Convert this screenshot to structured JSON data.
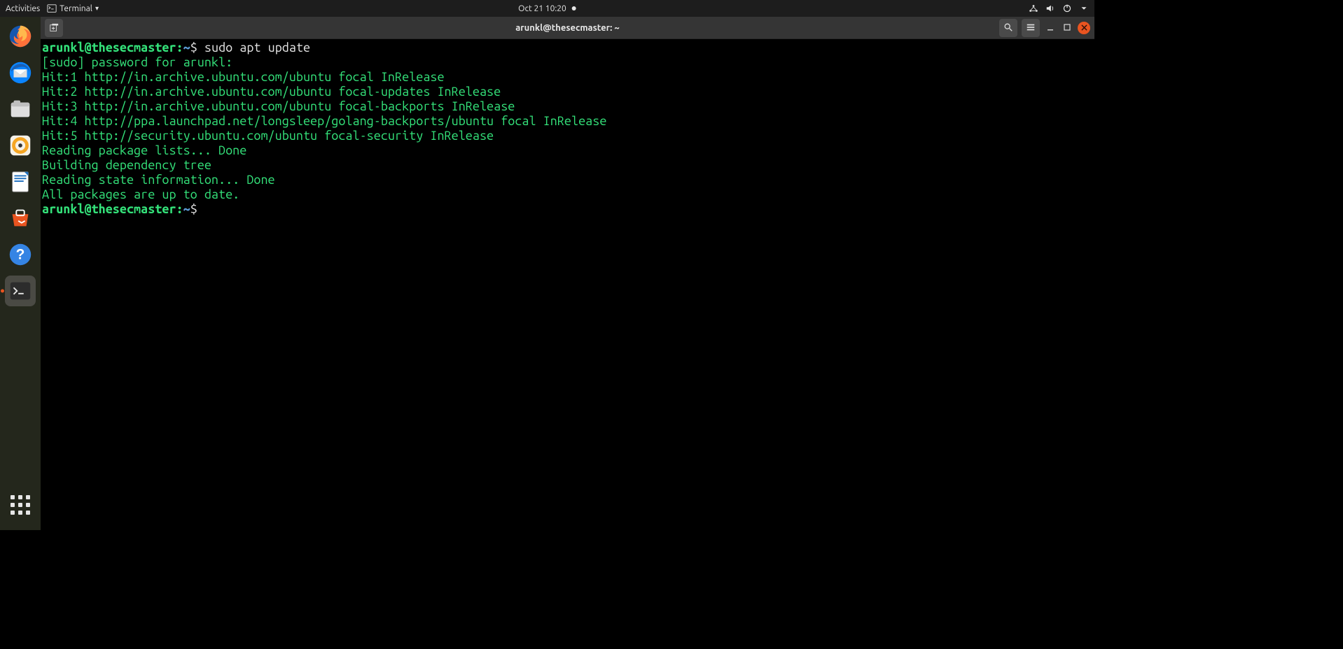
{
  "topbar": {
    "activities": "Activities",
    "terminal_label": "Terminal",
    "datetime": "Oct 21  10:20"
  },
  "dock_icons": [
    "firefox",
    "thunderbird",
    "files",
    "rhythmbox",
    "writer",
    "software",
    "help",
    "terminal"
  ],
  "window": {
    "title": "arunkl@thesecmaster: ~"
  },
  "terminal": {
    "prompt_user_host": "arunkl@thesecmaster",
    "prompt_path": "~",
    "prompt_symbol": "$",
    "command1": "sudo apt update",
    "output": [
      "[sudo] password for arunkl:",
      "Hit:1 http://in.archive.ubuntu.com/ubuntu focal InRelease",
      "Hit:2 http://in.archive.ubuntu.com/ubuntu focal-updates InRelease",
      "Hit:3 http://in.archive.ubuntu.com/ubuntu focal-backports InRelease",
      "Hit:4 http://ppa.launchpad.net/longsleep/golang-backports/ubuntu focal InRelease",
      "Hit:5 http://security.ubuntu.com/ubuntu focal-security InRelease",
      "Reading package lists... Done",
      "Building dependency tree",
      "Reading state information... Done",
      "All packages are up to date."
    ]
  }
}
